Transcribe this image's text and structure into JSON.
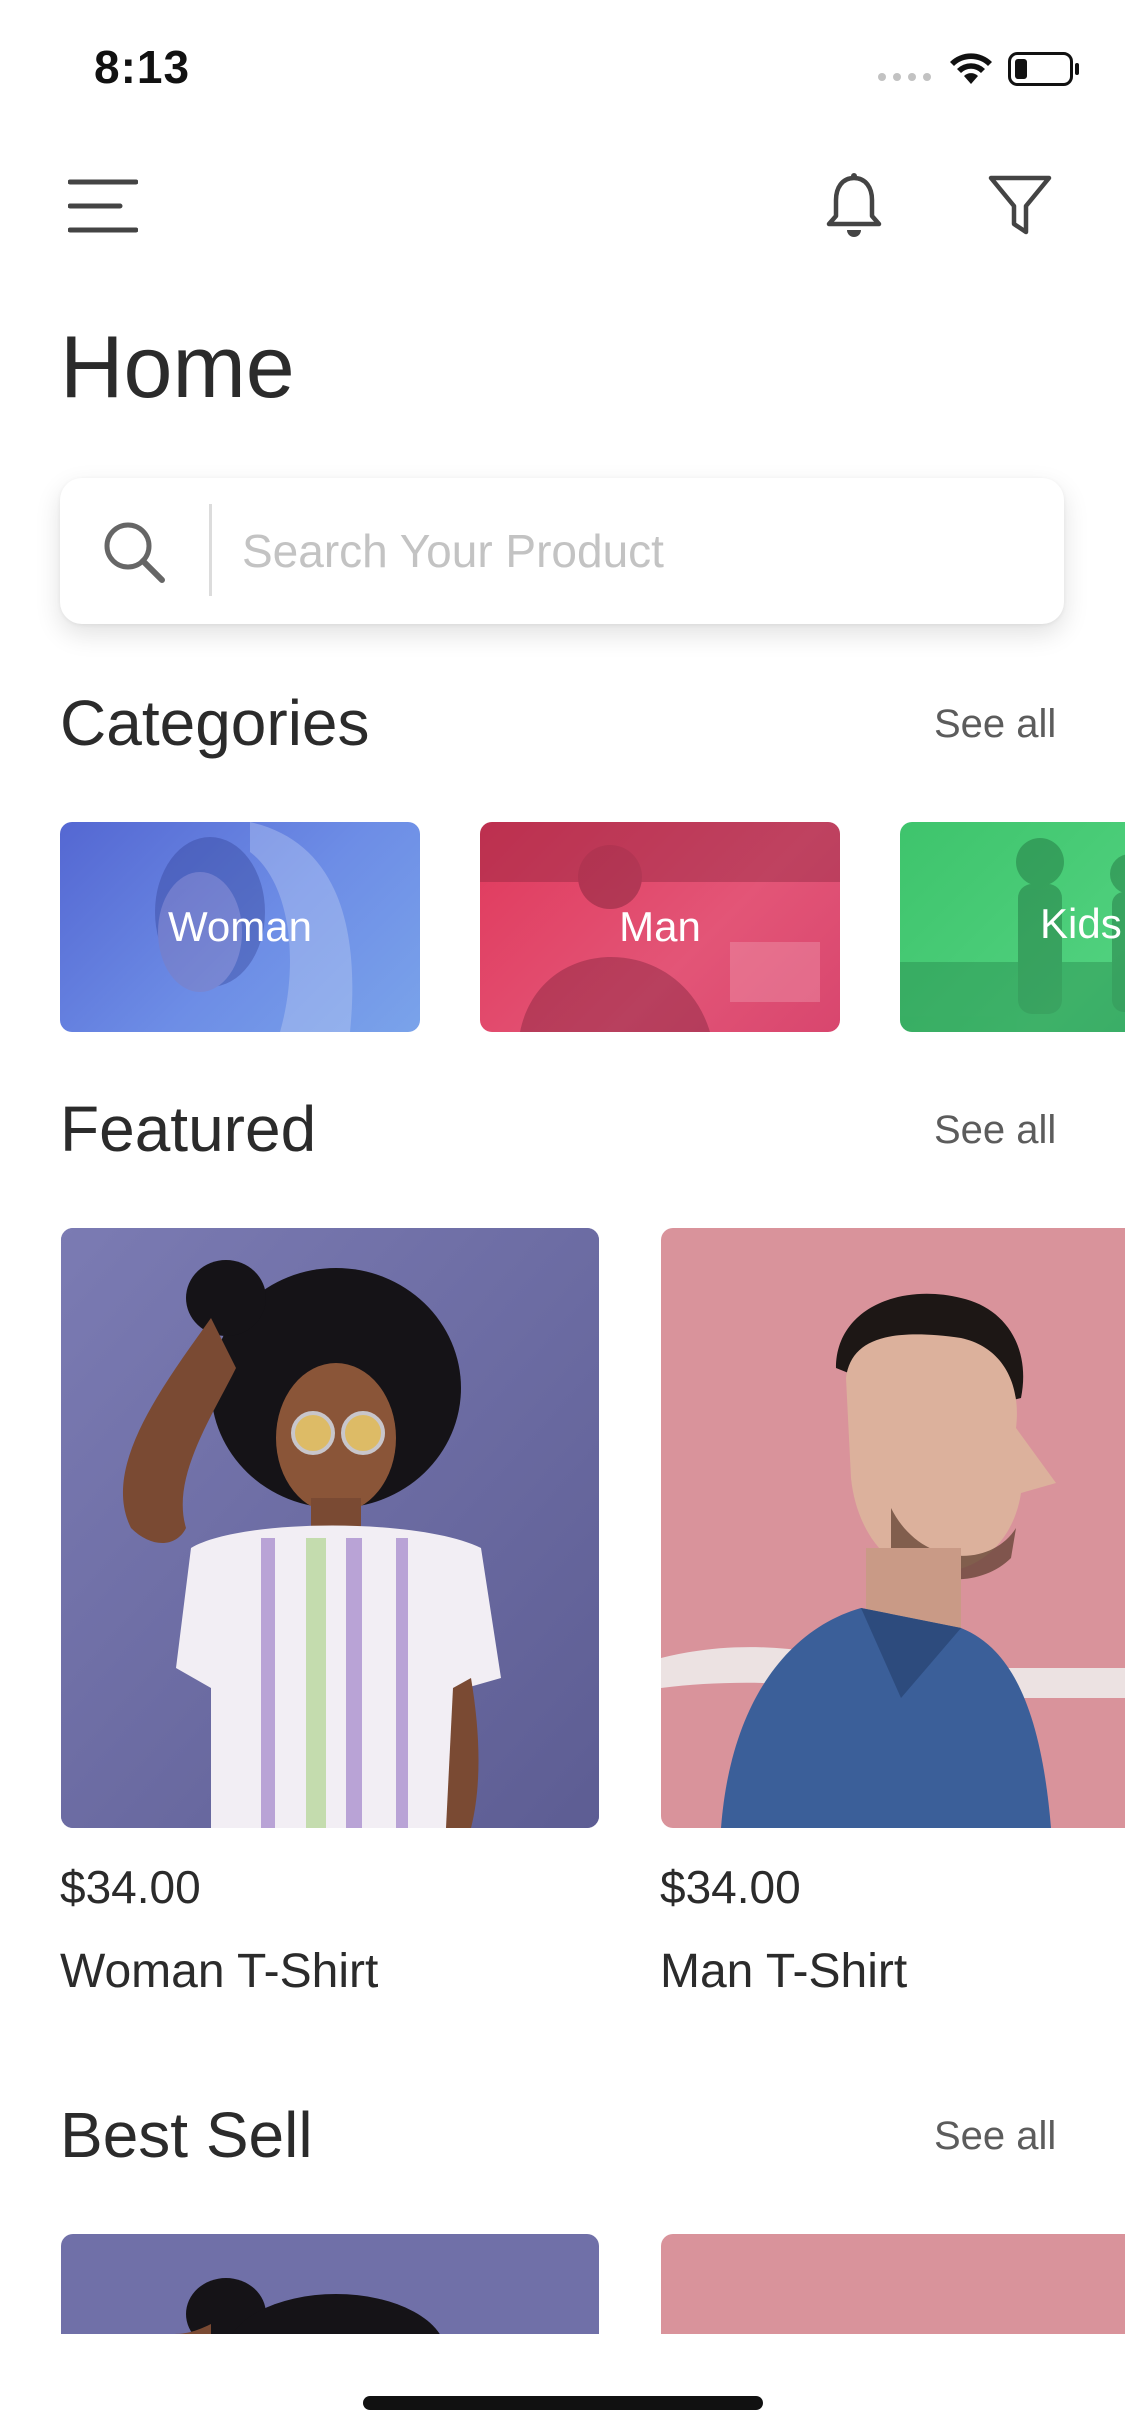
{
  "status_bar": {
    "time": "8:13"
  },
  "header": {
    "title": "Home",
    "icons": [
      "menu-icon",
      "bell-icon",
      "filter-icon"
    ]
  },
  "search": {
    "placeholder": "Search Your Product",
    "value": ""
  },
  "categories": {
    "title": "Categories",
    "see_all": "See all",
    "items": [
      {
        "label": "Woman",
        "color": "#5b73d6"
      },
      {
        "label": "Man",
        "color": "#e2466a"
      },
      {
        "label": "Kids",
        "color": "#45c873"
      }
    ]
  },
  "featured": {
    "title": "Featured",
    "see_all": "See all",
    "items": [
      {
        "price": "$34.00",
        "name": "Woman T-Shirt",
        "color": "#6f6fa6"
      },
      {
        "price": "$34.00",
        "name": "Man T-Shirt",
        "color": "#d9939b"
      }
    ]
  },
  "best_sell": {
    "title": "Best Sell",
    "see_all": "See all"
  }
}
